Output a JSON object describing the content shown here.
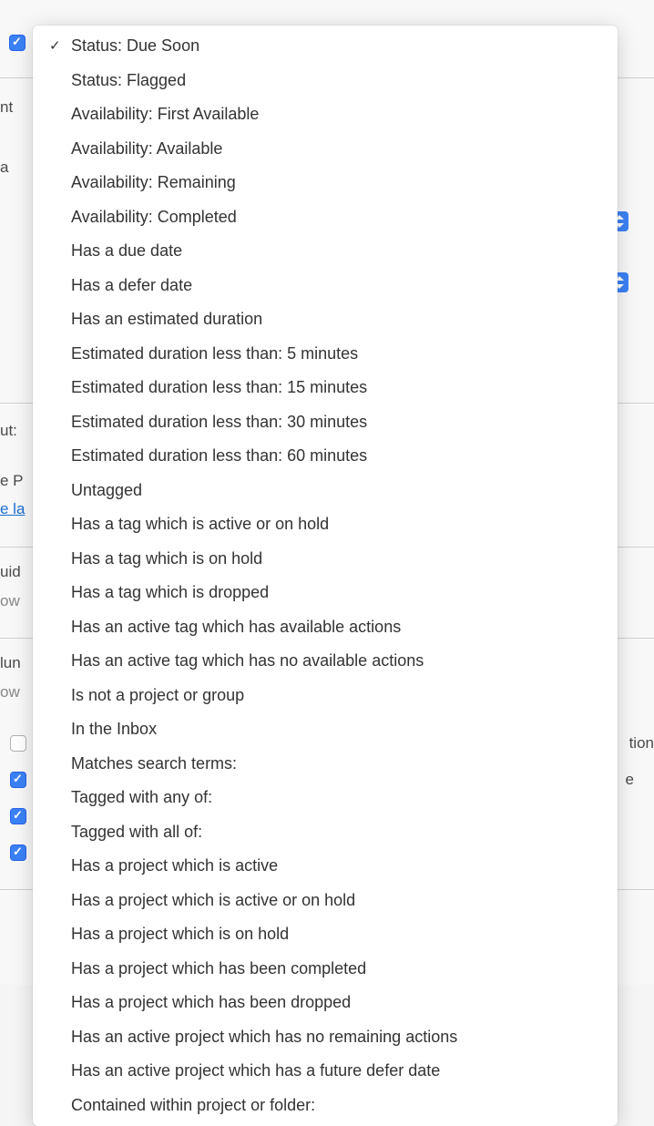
{
  "background": {
    "checkbox_top": true,
    "text_nt": "nt",
    "text_a": "a",
    "text_ut": "ut:",
    "text_ep": "e P",
    "text_ela": "e la",
    "text_uid": "uid",
    "text_ow1": "ow",
    "text_lun": "lun",
    "text_ow2": "ow",
    "text_tion": "tion",
    "text_e": "e",
    "checkboxes": [
      false,
      true,
      true,
      true
    ]
  },
  "menu": {
    "items": [
      {
        "label": "Status: Due Soon",
        "checked": true
      },
      {
        "label": "Status: Flagged",
        "checked": false
      },
      {
        "label": "Availability: First Available",
        "checked": false
      },
      {
        "label": "Availability: Available",
        "checked": false
      },
      {
        "label": "Availability: Remaining",
        "checked": false
      },
      {
        "label": "Availability: Completed",
        "checked": false
      },
      {
        "label": "Has a due date",
        "checked": false
      },
      {
        "label": "Has a defer date",
        "checked": false
      },
      {
        "label": "Has an estimated duration",
        "checked": false
      },
      {
        "label": "Estimated duration less than: 5 minutes",
        "checked": false
      },
      {
        "label": "Estimated duration less than: 15 minutes",
        "checked": false
      },
      {
        "label": "Estimated duration less than: 30 minutes",
        "checked": false
      },
      {
        "label": "Estimated duration less than: 60 minutes",
        "checked": false
      },
      {
        "label": "Untagged",
        "checked": false
      },
      {
        "label": "Has a tag which is active or on hold",
        "checked": false
      },
      {
        "label": "Has a tag which is on hold",
        "checked": false
      },
      {
        "label": "Has a tag which is dropped",
        "checked": false
      },
      {
        "label": "Has an active tag which has available actions",
        "checked": false
      },
      {
        "label": "Has an active tag which has no available actions",
        "checked": false
      },
      {
        "label": "Is not a project or group",
        "checked": false
      },
      {
        "label": "In the Inbox",
        "checked": false
      },
      {
        "label": "Matches search terms:",
        "checked": false
      },
      {
        "label": "Tagged with any of:",
        "checked": false
      },
      {
        "label": "Tagged with all of:",
        "checked": false
      },
      {
        "label": "Has a project which is active",
        "checked": false
      },
      {
        "label": "Has a project which is active or on hold",
        "checked": false
      },
      {
        "label": "Has a project which is on hold",
        "checked": false
      },
      {
        "label": "Has a project which has been completed",
        "checked": false
      },
      {
        "label": "Has a project which has been dropped",
        "checked": false
      },
      {
        "label": "Has an active project which has no remaining actions",
        "checked": false
      },
      {
        "label": "Has an active project which has a future defer date",
        "checked": false
      },
      {
        "label": "Contained within project or folder:",
        "checked": false
      }
    ]
  }
}
